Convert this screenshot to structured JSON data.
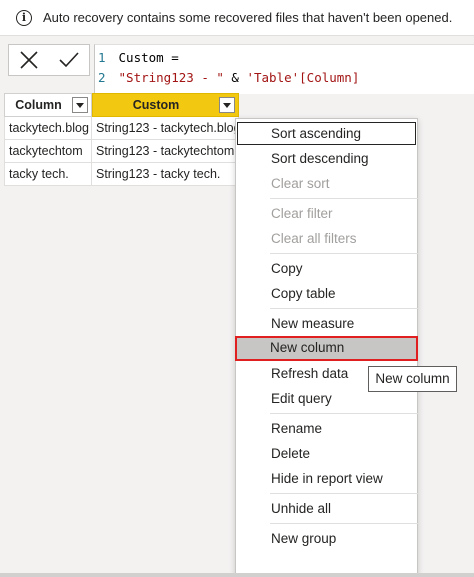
{
  "info_bar": {
    "icon": "info-icon",
    "icon_glyph": "i",
    "message": "Auto recovery contains some recovered files that haven't been opened."
  },
  "formula_bar": {
    "cancel_icon": "close-icon",
    "commit_icon": "checkmark-icon",
    "lines": [
      {
        "number": "1",
        "tokens": [
          {
            "text": "Custom =",
            "type": "plain"
          }
        ]
      },
      {
        "number": "2",
        "tokens": [
          {
            "text": "\"String123 - \"",
            "type": "string"
          },
          {
            "text": " & ",
            "type": "plain"
          },
          {
            "text": "'Table'[Column]",
            "type": "string"
          }
        ]
      }
    ]
  },
  "table": {
    "columns": [
      {
        "label": "Column",
        "highlight": false
      },
      {
        "label": "Custom",
        "highlight": true,
        "highlight_color": "#f2c811"
      }
    ],
    "rows": [
      [
        "tackytech.blog",
        "String123 - tackytech.blog"
      ],
      [
        "tackytechtom",
        "String123 - tackytechtom"
      ],
      [
        "tacky tech.",
        "String123 - tacky tech."
      ]
    ]
  },
  "context_menu": {
    "groups": [
      [
        {
          "label": "Sort ascending",
          "enabled": true,
          "state": "focused"
        },
        {
          "label": "Sort descending",
          "enabled": true
        },
        {
          "label": "Clear sort",
          "enabled": false
        }
      ],
      [
        {
          "label": "Clear filter",
          "enabled": false
        },
        {
          "label": "Clear all filters",
          "enabled": false
        }
      ],
      [
        {
          "label": "Copy",
          "enabled": true
        },
        {
          "label": "Copy table",
          "enabled": true
        }
      ],
      [
        {
          "label": "New measure",
          "enabled": true
        },
        {
          "label": "New column",
          "enabled": true,
          "state": "hover"
        },
        {
          "label": "Refresh data",
          "enabled": true
        },
        {
          "label": "Edit query",
          "enabled": true
        }
      ],
      [
        {
          "label": "Rename",
          "enabled": true
        },
        {
          "label": "Delete",
          "enabled": true
        },
        {
          "label": "Hide in report view",
          "enabled": true
        }
      ],
      [
        {
          "label": "Unhide all",
          "enabled": true
        }
      ],
      [
        {
          "label": "New group",
          "enabled": true
        }
      ]
    ]
  },
  "tooltip": {
    "text": "New column"
  },
  "colors": {
    "accent_yellow": "#f2c811",
    "highlight_red": "#e02020",
    "disabled_text": "#a19f9d"
  }
}
